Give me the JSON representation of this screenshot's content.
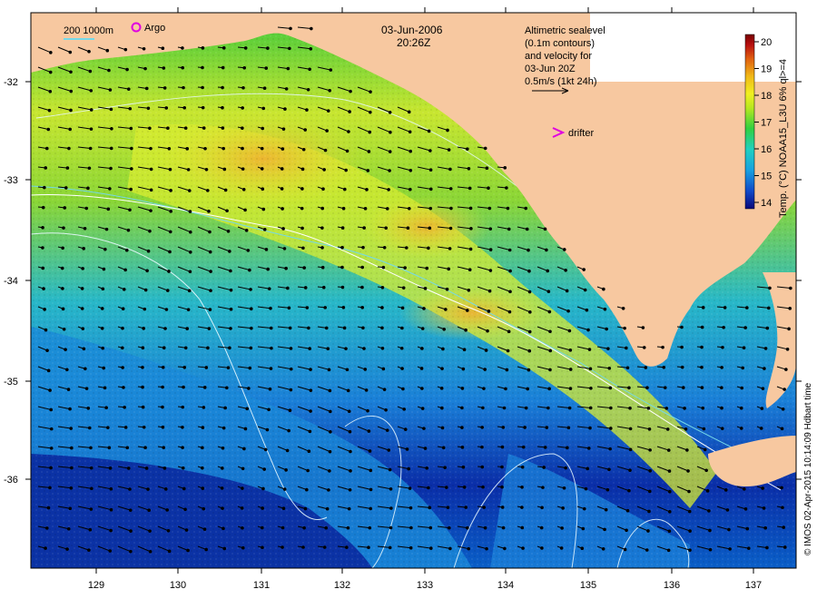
{
  "header": {
    "date": "03-Jun-2006",
    "time": "20:26Z"
  },
  "scale_legend": {
    "isobath_label": "200 1000m",
    "argo_label": "Argo",
    "drifter_label": "drifter"
  },
  "altimetry_note": {
    "lines": [
      "Altimetric sealevel",
      "(0.1m contours)",
      "and velocity for",
      "03-Jun 20Z",
      "0.5m/s (1kt 24h)"
    ]
  },
  "axes": {
    "x_ticks": [
      "129",
      "130",
      "131",
      "132",
      "133",
      "134",
      "135",
      "136",
      "137"
    ],
    "y_ticks": [
      "-32",
      "-33",
      "-34",
      "-35",
      "-36"
    ]
  },
  "colorbar": {
    "ticks": [
      "20",
      "19",
      "18",
      "17",
      "16",
      "15",
      "14"
    ],
    "title": "Temp. (°C) NOAA15_L3U 6% ql>=4",
    "colors": [
      "#08087a",
      "#1048c8",
      "#18a0e0",
      "#20d0c0",
      "#30d040",
      "#b8e820",
      "#f0f020",
      "#f0b818",
      "#e06010",
      "#b81010",
      "#780000"
    ]
  },
  "credit": {
    "text": "© IMOS 02-Apr-2015 10:14:09 Hdbart time"
  },
  "colors": {
    "land": "#f7c8a0",
    "isobath_200": "#74d8e8",
    "isobath_1000": "#ffffff",
    "argo": "#e000e0",
    "drifter": "#e000e0"
  }
}
